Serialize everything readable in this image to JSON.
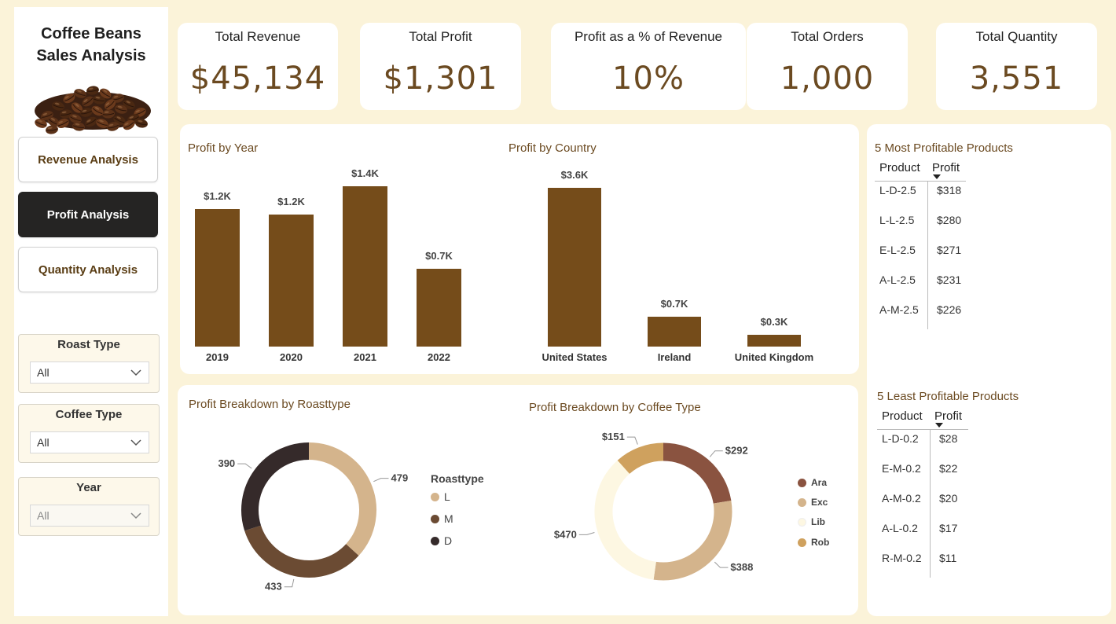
{
  "sidebar": {
    "title_line1": "Coffee Beans",
    "title_line2": "Sales Analysis",
    "nav": [
      {
        "label": "Revenue Analysis",
        "active": false
      },
      {
        "label": "Profit Analysis",
        "active": true
      },
      {
        "label": "Quantity Analysis",
        "active": false
      }
    ],
    "slicers": [
      {
        "title": "Roast Type",
        "value": "All"
      },
      {
        "title": "Coffee Type",
        "value": "All"
      },
      {
        "title": "Year",
        "value": "All"
      }
    ]
  },
  "kpis": [
    {
      "title": "Total Revenue",
      "value": "$45,134"
    },
    {
      "title": "Total Profit",
      "value": "$1,301"
    },
    {
      "title": "Profit as a % of Revenue",
      "value": "10%"
    },
    {
      "title": "Total Orders",
      "value": "1,000"
    },
    {
      "title": "Total Quantity",
      "value": "3,551"
    }
  ],
  "colors": {
    "bar": "#754C1A",
    "roast": {
      "L": "#D4B48C",
      "M": "#6B4B33",
      "D": "#352A2A"
    },
    "coffee": {
      "Ara": "#8A5340",
      "Exc": "#D4B48C",
      "Lib": "#FDF7E2",
      "Rob": "#CFA15E"
    }
  },
  "chart_data": [
    {
      "type": "bar",
      "title": "Profit by Year",
      "categories": [
        "2019",
        "2020",
        "2021",
        "2022"
      ],
      "values": [
        1200,
        1150,
        1400,
        680
      ],
      "data_labels": [
        "$1.2K",
        "$1.2K",
        "$1.4K",
        "$0.7K"
      ]
    },
    {
      "type": "bar",
      "title": "Profit by Country",
      "categories": [
        "United States",
        "Ireland",
        "United Kingdom"
      ],
      "values": [
        3600,
        680,
        270
      ],
      "data_labels": [
        "$3.6K",
        "$0.7K",
        "$0.3K"
      ]
    },
    {
      "type": "pie",
      "title": "Profit Breakdown by Roasttype",
      "legend_title": "Roasttype",
      "categories": [
        "L",
        "M",
        "D"
      ],
      "values": [
        479,
        433,
        390
      ],
      "data_labels": [
        "479",
        "433",
        "390"
      ]
    },
    {
      "type": "pie",
      "title": "Profit Breakdown by Coffee Type",
      "categories": [
        "Ara",
        "Exc",
        "Lib",
        "Rob"
      ],
      "values": [
        292,
        388,
        470,
        151
      ],
      "data_labels": [
        "$292",
        "$388",
        "$470",
        "$151"
      ]
    },
    {
      "type": "table",
      "title": "5 Most Profitable Products",
      "columns": [
        "Product",
        "Profit"
      ],
      "rows": [
        [
          "L-D-2.5",
          "$318"
        ],
        [
          "L-L-2.5",
          "$280"
        ],
        [
          "E-L-2.5",
          "$271"
        ],
        [
          "A-L-2.5",
          "$231"
        ],
        [
          "A-M-2.5",
          "$226"
        ]
      ]
    },
    {
      "type": "table",
      "title": "5 Least Profitable Products",
      "columns": [
        "Product",
        "Profit"
      ],
      "rows": [
        [
          "L-D-0.2",
          "$28"
        ],
        [
          "E-M-0.2",
          "$22"
        ],
        [
          "A-M-0.2",
          "$20"
        ],
        [
          "A-L-0.2",
          "$17"
        ],
        [
          "R-M-0.2",
          "$11"
        ]
      ]
    }
  ]
}
